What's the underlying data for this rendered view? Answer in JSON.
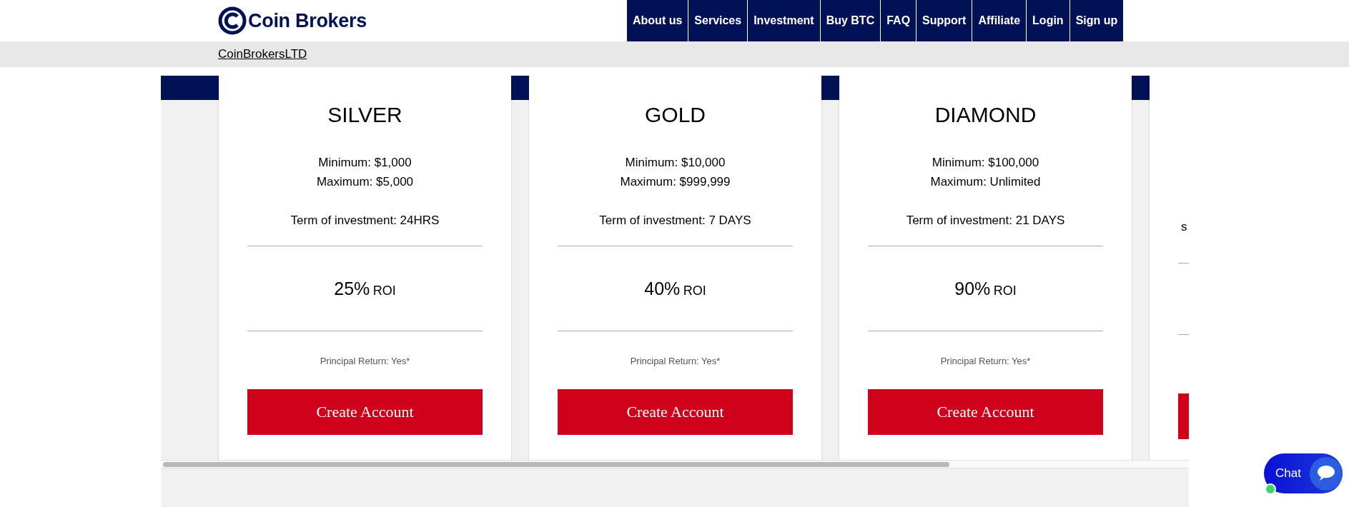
{
  "header": {
    "logo": "Coin Brokers",
    "nav": [
      "About us",
      "Services",
      "Investment",
      "Buy BTC",
      "FAQ",
      "Support",
      "Affiliate",
      "Login",
      "Sign up"
    ]
  },
  "breadcrumb": {
    "link": "CoinBrokersLTD"
  },
  "plans": [
    {
      "name": "SILVER",
      "minimum": "Minimum: $1,000",
      "maximum": "Maximum: $5,000",
      "term": "Term of investment: 24HRS",
      "roi_value": "25%",
      "roi_unit": "ROI",
      "principal": "Principal Return: Yes*",
      "button": "Create Account"
    },
    {
      "name": "GOLD",
      "minimum": "Minimum: $10,000",
      "maximum": "Maximum: $999,999",
      "term": "Term of investment: 7 DAYS",
      "roi_value": "40%",
      "roi_unit": "ROI",
      "principal": "Principal Return: Yes*",
      "button": "Create Account"
    },
    {
      "name": "DIAMOND",
      "minimum": "Minimum: $100,000",
      "maximum": "Maximum: Unlimited",
      "term": "Term of investment: 21 DAYS",
      "roi_value": "90%",
      "roi_unit": "ROI",
      "principal": "Principal Return: Yes*",
      "button": "Create Account"
    }
  ],
  "partial_plan": {
    "term": "s"
  },
  "chat": {
    "label": "Chat",
    "online": true
  }
}
